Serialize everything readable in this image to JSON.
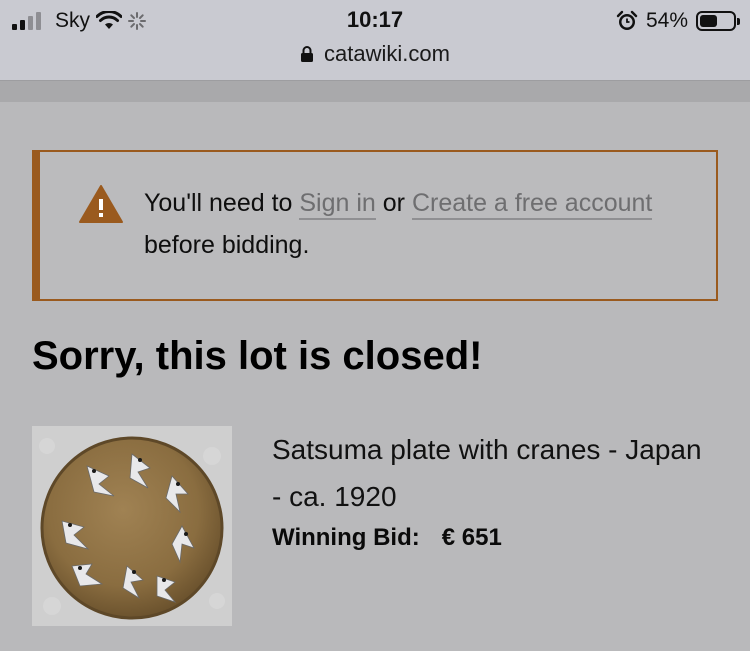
{
  "status_bar": {
    "carrier": "Sky",
    "time": "10:17",
    "battery_percent": "54%",
    "battery_level": 0.54,
    "icons": [
      "signal-icon",
      "wifi-icon",
      "loading-spinner-icon",
      "alarm-icon",
      "battery-icon"
    ]
  },
  "url_bar": {
    "domain": "catawiki.com",
    "icon": "lock-icon"
  },
  "alert": {
    "icon": "warning-icon",
    "text_before": "You'll need to ",
    "signin_link": "Sign in",
    "text_or": " or ",
    "create_link": "Create a free account",
    "text_after": " before bidding.",
    "border_color": "#9a5a1e"
  },
  "page": {
    "title": "Sorry, this lot is closed!"
  },
  "lot": {
    "title": "Satsuma plate with cranes - Japan - ca. 1920",
    "winning_label": "Winning Bid:",
    "winning_value": "€ 651"
  }
}
